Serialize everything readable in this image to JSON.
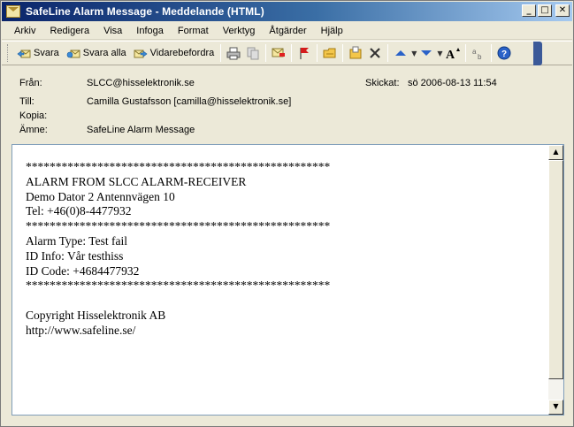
{
  "window": {
    "title": "SafeLine Alarm Message - Meddelande (HTML)",
    "controls": {
      "minimize": "_",
      "maximize": "□",
      "close": "✕"
    }
  },
  "menu": [
    "Arkiv",
    "Redigera",
    "Visa",
    "Infoga",
    "Format",
    "Verktyg",
    "Åtgärder",
    "Hjälp"
  ],
  "toolbar": {
    "reply": "Svara",
    "reply_all": "Svara alla",
    "forward": "Vidarebefordra",
    "icons": [
      "print-icon",
      "copy-icon",
      "flag-message-icon",
      "flag-icon",
      "move-to-folder-icon",
      "copy-to-folder-icon",
      "delete-icon",
      "previous-item-icon",
      "next-item-icon",
      "font-size-icon",
      "spelling-icon",
      "help-icon"
    ]
  },
  "header": {
    "from_label": "Från:",
    "from_value": "SLCC@hisselektronik.se",
    "sent_label": "Skickat:",
    "sent_value": "sö 2006-08-13 11:54",
    "to_label": "Till:",
    "to_value": "Camilla Gustafsson [camilla@hisselektronik.se]",
    "cc_label": "Kopia:",
    "cc_value": "",
    "subject_label": "Ämne:",
    "subject_value": "SafeLine Alarm Message"
  },
  "message": {
    "stars1": "***************************************************",
    "line1": "ALARM FROM SLCC ALARM-RECEIVER",
    "line2": "Demo Dator 2 Antennvägen 10",
    "line3": "Tel: +46(0)8-4477932",
    "stars2": "***************************************************",
    "line4": "Alarm Type: Test fail",
    "line5": "ID Info: Vår testhiss",
    "line6": "ID Code: +4684477932",
    "stars3": "***************************************************",
    "line7": "Copyright Hisselektronik AB",
    "line8": "http://www.safeline.se/"
  }
}
